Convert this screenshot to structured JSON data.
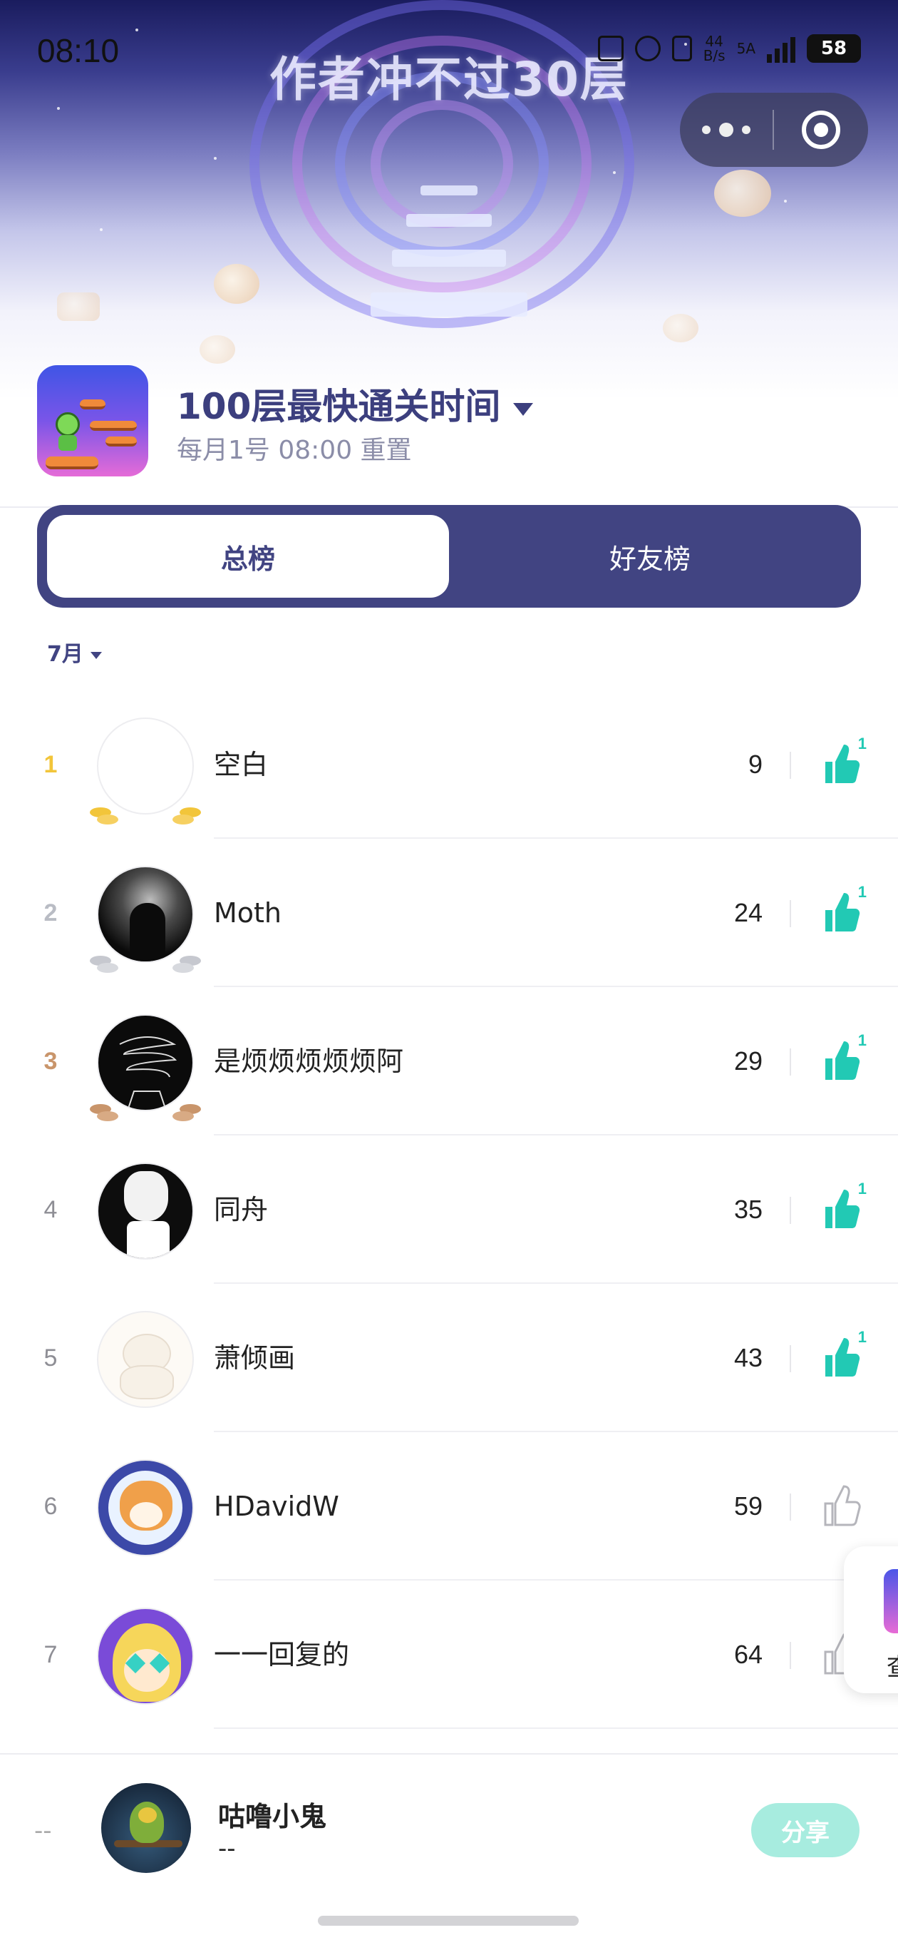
{
  "status_bar": {
    "time": "08:10",
    "net_speed": "44\nB/s",
    "net_type": "5A",
    "battery": "58"
  },
  "banner": {
    "game_title": "作者冲不过30层"
  },
  "board": {
    "title": "100层最快通关时间",
    "subtitle": "每月1号 08:00 重置"
  },
  "tabs": [
    {
      "label": "总榜",
      "active": true
    },
    {
      "label": "好友榜",
      "active": false
    }
  ],
  "filter": {
    "month": "7月"
  },
  "rows": [
    {
      "rank": "1",
      "name": "空白",
      "score": "9",
      "likes": "1",
      "liked": true
    },
    {
      "rank": "2",
      "name": "Moth",
      "score": "24",
      "likes": "1",
      "liked": true
    },
    {
      "rank": "3",
      "name": "是烦烦烦烦烦阿",
      "score": "29",
      "likes": "1",
      "liked": true
    },
    {
      "rank": "4",
      "name": "同舟",
      "score": "35",
      "likes": "1",
      "liked": true
    },
    {
      "rank": "5",
      "name": "萧倾画",
      "score": "43",
      "likes": "1",
      "liked": true
    },
    {
      "rank": "6",
      "name": "HDavidW",
      "score": "59",
      "likes": "",
      "liked": false
    },
    {
      "rank": "7",
      "name": "一一回复的",
      "score": "64",
      "likes": "",
      "liked": false
    }
  ],
  "floating_card": {
    "label": "查"
  },
  "me": {
    "rank": "--",
    "name": "咕噜小鬼",
    "score": "--",
    "share_label": "分享"
  },
  "colors": {
    "accent": "#414482",
    "like": "#22c9b4",
    "gold": "#f2c53a",
    "silver": "#b9bcc4",
    "bronze": "#c9956b"
  }
}
